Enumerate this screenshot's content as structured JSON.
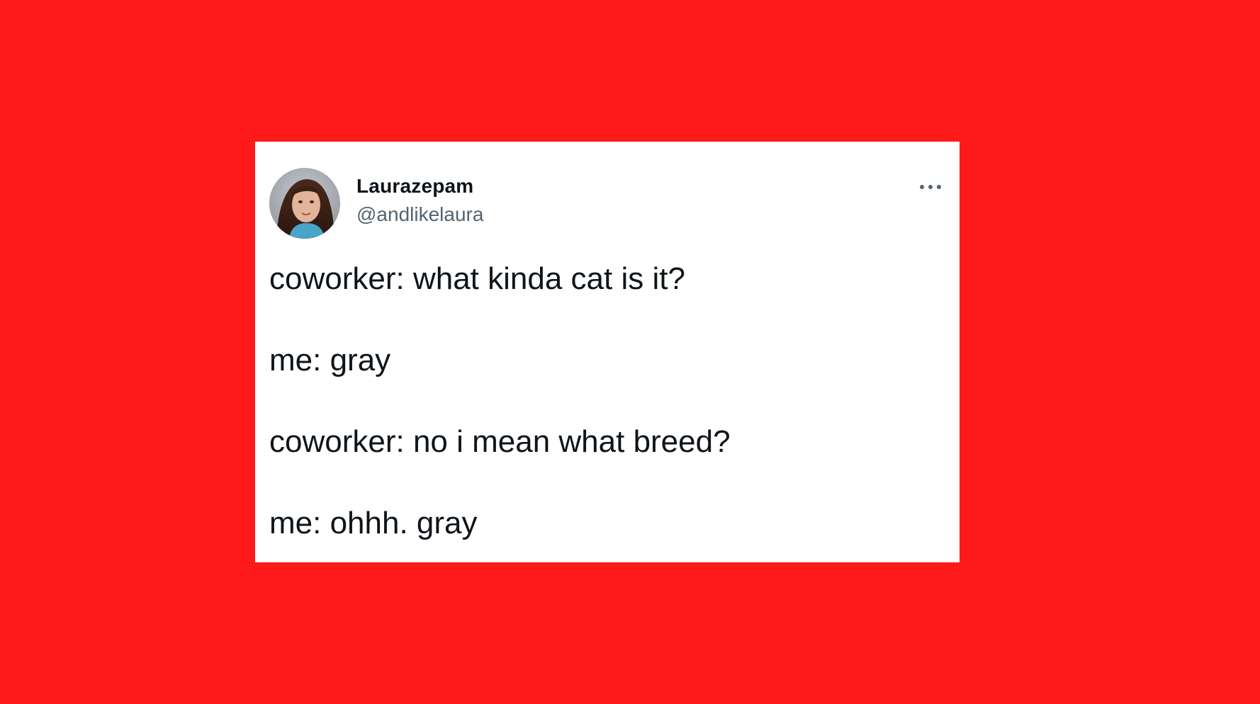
{
  "background_color": "#ff1a1a",
  "tweet": {
    "author": {
      "display_name": "Laurazepam",
      "handle": "@andlikelaura",
      "avatar_icon": "profile-photo"
    },
    "more_icon": "more-options-icon",
    "lines": [
      "coworker: what kinda cat is it?",
      "me: gray",
      "coworker: no i mean what breed?",
      "me: ohhh. gray"
    ]
  }
}
